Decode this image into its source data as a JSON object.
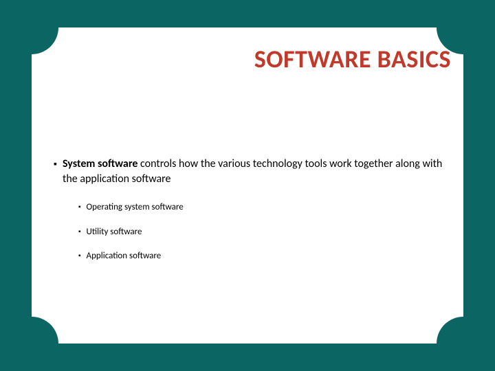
{
  "title": "SOFTWARE BASICS",
  "main": {
    "bold": "System software",
    "rest": "  controls how the various technology tools work together along with the application software"
  },
  "subs": {
    "a": "Operating system software",
    "b": "Utility software",
    "c": "Application software"
  },
  "colors": {
    "bg": "#0a6563",
    "title": "#c0392b"
  }
}
